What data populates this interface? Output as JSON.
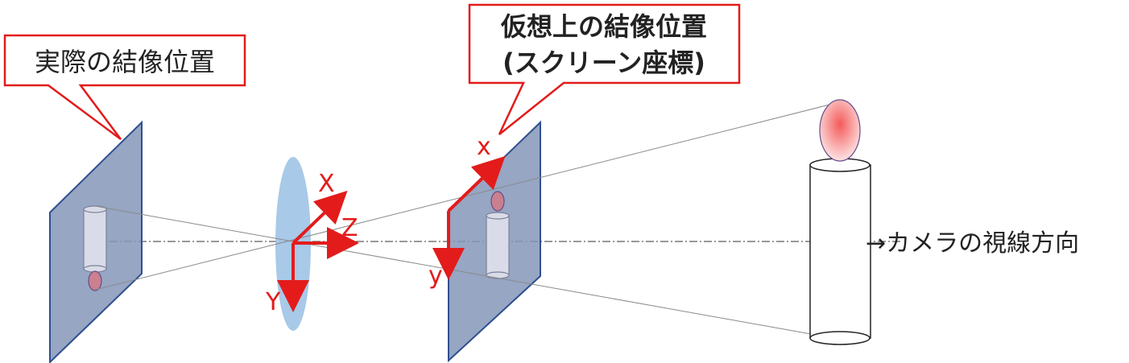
{
  "callouts": {
    "actual": {
      "text": "実際の結像位置"
    },
    "virtual": {
      "line1": "仮想上の結像位置",
      "line2": "(スクリーン座標)"
    }
  },
  "lens_axes": {
    "x": "X",
    "y": "Y",
    "z": "Z"
  },
  "screen_axes": {
    "x": "x",
    "y": "y"
  },
  "view_direction_label": "→カメラの視線方向",
  "colors": {
    "callout_border": "#e31b1b",
    "axis_arrow": "#e31b1b",
    "plane_fill": "#8497b9",
    "plane_edge": "#2f4f8f",
    "lens_fill": "#9ec3e6",
    "flame": "#f08080"
  }
}
